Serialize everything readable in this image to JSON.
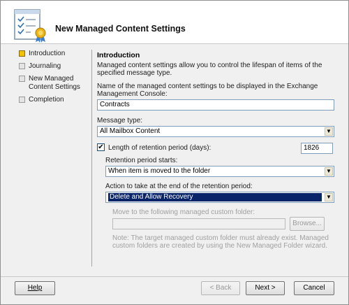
{
  "header": {
    "title": "New Managed Content Settings",
    "icon": "wizard-certificate-icon"
  },
  "nav": {
    "items": [
      {
        "label": "Introduction",
        "active": true
      },
      {
        "label": "Journaling",
        "active": false
      },
      {
        "label": "New Managed Content Settings",
        "active": false
      },
      {
        "label": "Completion",
        "active": false
      }
    ]
  },
  "content": {
    "heading": "Introduction",
    "description": "Managed content settings allow you to control the lifespan of items of the specified message type.",
    "name_label": "Name of the managed content settings to be displayed in the Exchange Management Console:",
    "name_value": "Contracts",
    "message_type_label": "Message type:",
    "message_type_value": "All Mailbox Content",
    "retention_checkbox_label": "Length of retention period (days):",
    "retention_checked": true,
    "retention_days": "1826",
    "retention_starts_label": "Retention period starts:",
    "retention_starts_value": "When item is moved to the folder",
    "action_label": "Action to take at the end of the retention period:",
    "action_value": "Delete and Allow Recovery",
    "move_label": "Move to the following managed custom folder:",
    "move_value": "",
    "browse_label": "Browse...",
    "note": "Note: The target managed custom folder must already exist. Managed custom folders are created by using the New Managed Folder wizard."
  },
  "footer": {
    "help": "Help",
    "back": "< Back",
    "next": "Next >",
    "cancel": "Cancel"
  }
}
